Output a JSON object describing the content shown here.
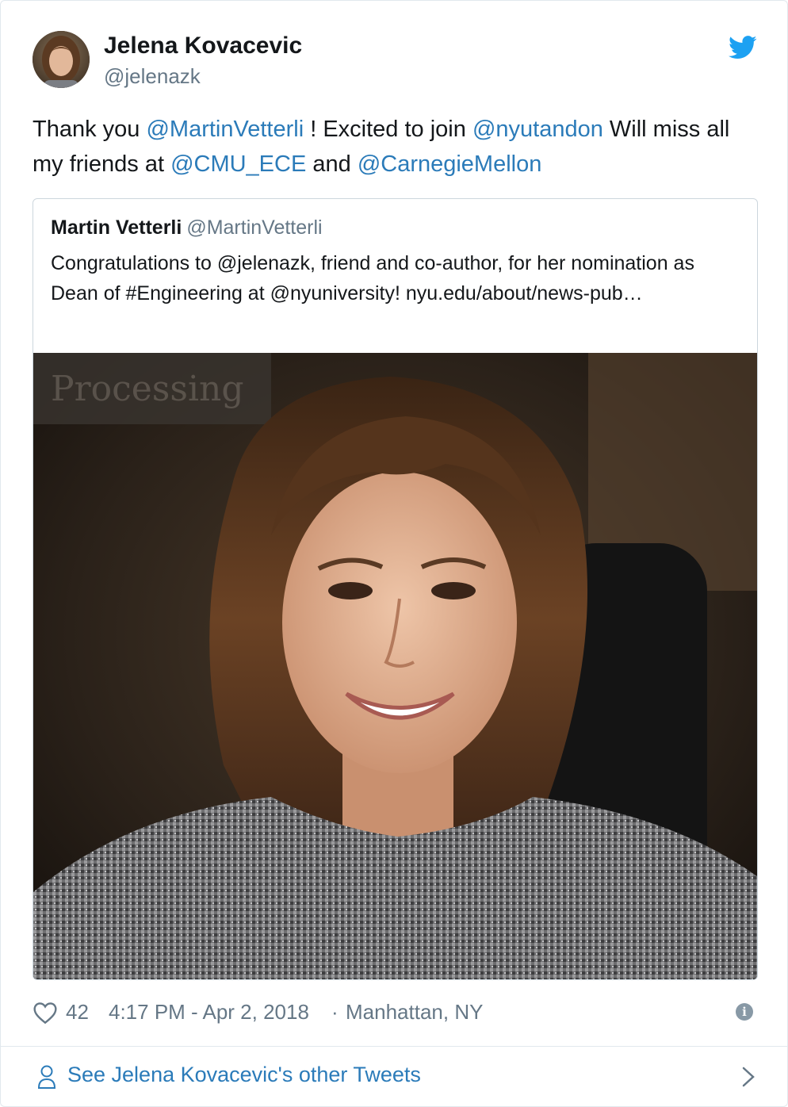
{
  "author": {
    "name": "Jelena Kovacevic",
    "handle": "@jelenazk"
  },
  "tweet": {
    "parts": [
      {
        "text": "Thank you ",
        "type": "text"
      },
      {
        "text": "@MartinVetterli",
        "type": "mention"
      },
      {
        "text": " ! Excited to join ",
        "type": "text"
      },
      {
        "text": "@nyutandon",
        "type": "mention"
      },
      {
        "text": " Will miss all my friends at ",
        "type": "text"
      },
      {
        "text": "@CMU_ECE",
        "type": "mention"
      },
      {
        "text": " and ",
        "type": "text"
      },
      {
        "text": "@CarnegieMellon",
        "type": "mention"
      }
    ]
  },
  "quoted": {
    "name": "Martin Vetterli",
    "handle": "@MartinVetterli",
    "text": "Congratulations to @jelenazk, friend and co-author, for her nomination as Dean of #Engineering at @nyuniversity! nyu.edu/about/news-pub…",
    "photo_text": "Processing"
  },
  "meta": {
    "likes": "42",
    "time": "4:17 PM - Apr 2, 2018",
    "separator": "·",
    "location": "Manhattan, NY",
    "info_glyph": "i"
  },
  "footer": {
    "see_more": "See Jelena Kovacevic's other Tweets"
  },
  "colors": {
    "link": "#2b7bb9",
    "twitter_blue": "#1da1f2",
    "muted": "#657786"
  },
  "icons": [
    "twitter-bird-icon",
    "heart-icon",
    "info-icon",
    "person-icon",
    "chevron-right-icon"
  ]
}
